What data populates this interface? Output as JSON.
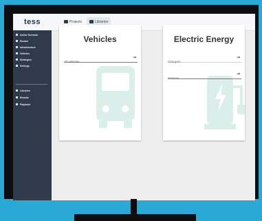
{
  "app": {
    "logo": "tess"
  },
  "topbar": {
    "tabs": [
      {
        "label": "Projects"
      },
      {
        "label": "Libraries"
      }
    ]
  },
  "sidebar": {
    "items": [
      {
        "label": "Active Scenario"
      },
      {
        "label": "Routes"
      },
      {
        "label": "Infrastructure"
      },
      {
        "label": "Vehicles"
      },
      {
        "label": "Strategies"
      },
      {
        "label": "Settings"
      }
    ],
    "bottom_items": [
      {
        "label": "Libraries"
      },
      {
        "label": "Results"
      },
      {
        "label": "Playback"
      }
    ]
  },
  "cards": [
    {
      "title": "Vehicles",
      "rows": [
        {
          "label": "All vehicles"
        }
      ]
    },
    {
      "title": "Electric Energy",
      "rows": [
        {
          "label": "Chargers"
        },
        {
          "label": "Stations"
        }
      ]
    }
  ],
  "colors": {
    "background": "#2aa8d6",
    "bezel": "#0e0e10",
    "sidebar": "#2f3a4a",
    "watermark": "#dbeeea"
  }
}
